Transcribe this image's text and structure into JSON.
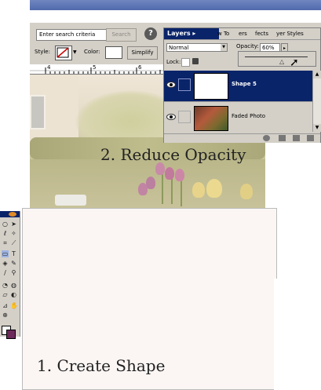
{
  "options_bar": {
    "search_placeholder": "Enter search criteria",
    "search_button": "Search",
    "help_icon": "?",
    "style_label": "Style:",
    "color_label": "Color:",
    "simplify_button": "Simplify"
  },
  "ruler": {
    "labels": [
      "4",
      "5",
      "6"
    ]
  },
  "layers_palette": {
    "tabs": [
      "Layers",
      "w To",
      "ers",
      "fects",
      "yer Styles"
    ],
    "blend_mode": "Normal",
    "opacity_label": "Opacity:",
    "opacity_value": "60%",
    "lock_label": "Lock:",
    "layers": [
      {
        "name": "Shape 5",
        "selected": true
      },
      {
        "name": "Faded Photo",
        "selected": false
      }
    ]
  },
  "captions": {
    "reduce_opacity": "2. Reduce Opacity",
    "create_shape": "1. Create Shape"
  },
  "colors": {
    "selection": "#0a246a",
    "panel": "#d4d0c8",
    "canvas": "#fbf6f4",
    "foreground_swatch": "#ffffff",
    "background_swatch": "#6b2a5a"
  }
}
